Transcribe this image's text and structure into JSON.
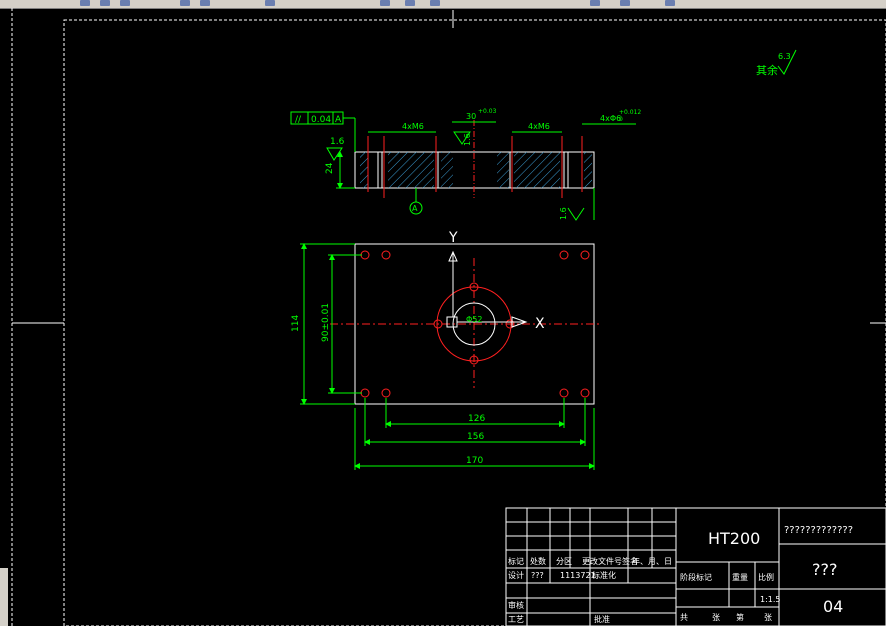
{
  "drawing": {
    "roughness_note": "其余",
    "roughness_value": "6.3",
    "section": {
      "flatness_tol": "0.04",
      "flatness_datum": "A",
      "ra_top": "1.6",
      "ra_slot": "1.6",
      "ra_bottom": "1.6",
      "height": "24",
      "holes_left": "4xM6",
      "holes_right": "4xM6",
      "bore": "30",
      "bore_tol": "+0.03",
      "pin_holes": "4xΦ6",
      "pin_tol_upper": "+0.012",
      "pin_tol_lower": "0",
      "datum_label": "A"
    },
    "plan": {
      "axis_y": "Y",
      "axis_x": "X",
      "height_outer": "114",
      "height_inner": "90±0.01",
      "width_1": "126",
      "width_2": "156",
      "width_3": "170",
      "center_label": "Φ52"
    }
  },
  "title_block": {
    "material": "HT200",
    "part_name": "?????????????",
    "drawing_no": "???",
    "sheet": "04",
    "scale": "1:1.5",
    "rev_headers": [
      "标记",
      "处数",
      "分区",
      "更改文件号",
      "签名",
      "年、月、日"
    ],
    "design_row": [
      "设计",
      "???",
      "1113721",
      "标准化"
    ],
    "stage_labels": [
      "阶段标记",
      "重量",
      "比例"
    ],
    "review_label": "审核",
    "process_label": "工艺",
    "approve_label": "批准",
    "sheet_labels": [
      "共",
      "张",
      "第",
      "张"
    ]
  }
}
